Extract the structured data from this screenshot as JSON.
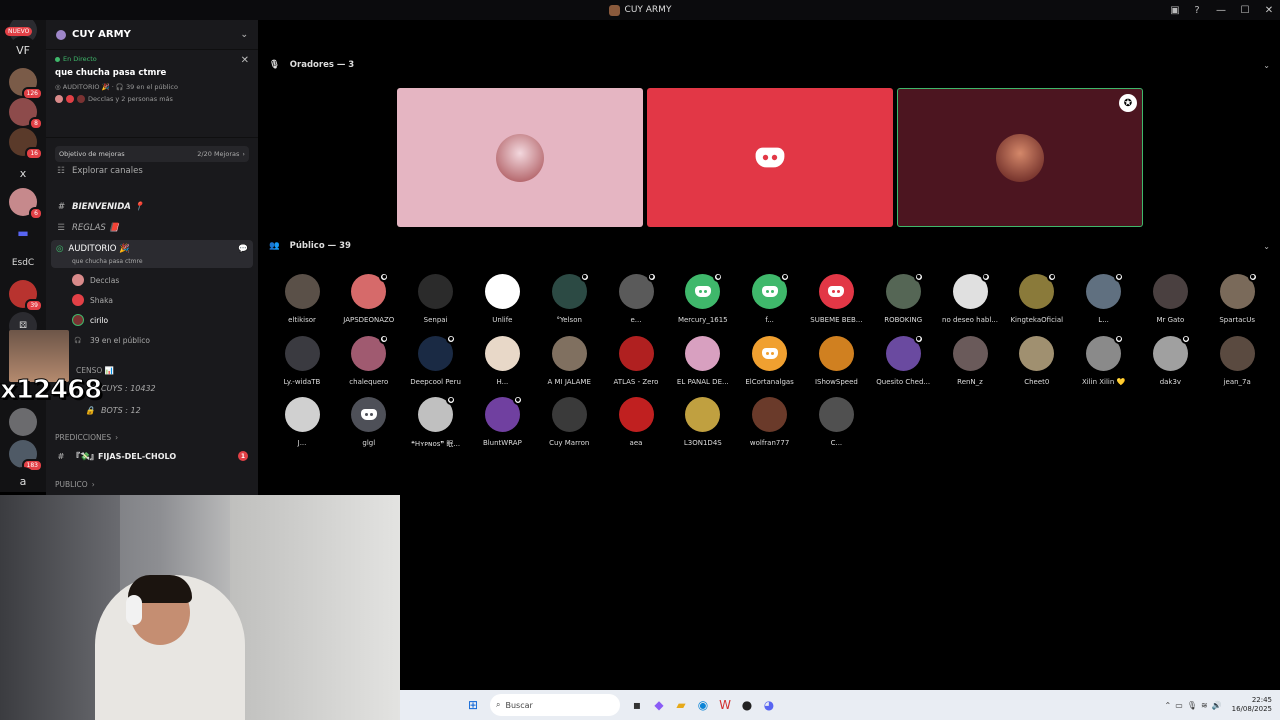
{
  "window": {
    "title": "CUY ARMY"
  },
  "rail": {
    "items": [
      {
        "label": "sr",
        "badge": "NUEVO"
      },
      {
        "label": "VF"
      },
      {
        "badge": "126"
      },
      {
        "badge": "8"
      },
      {
        "badge": "16"
      },
      {
        "label": "x"
      },
      {
        "badge": "6"
      },
      {
        "label": "EsdC"
      },
      {
        "badge": "39"
      },
      {
        "badge": "183"
      },
      {
        "label": "a"
      }
    ]
  },
  "overlay": {
    "number": "x12468"
  },
  "server": {
    "name": "CUY ARMY"
  },
  "live": {
    "status": "En Directo",
    "title": "que chucha pasa ctmre",
    "channel": "AUDITORIO 🎉",
    "audience": "39 en el público",
    "people": "Decclas y 2 personas más"
  },
  "goal": {
    "label": "Objetivo de mejoras",
    "value": "2/20 Mejoras"
  },
  "explore": "Explorar canales",
  "channels": [
    {
      "name": "BIENVENIDA 📍",
      "sym": "#"
    },
    {
      "name": "REGLAS 📕",
      "sym": "☰"
    }
  ],
  "stage_channel": {
    "name": "AUDITORIO 🎉",
    "topic": "que chucha pasa ctmre"
  },
  "stage_members": [
    {
      "name": "Decclas"
    },
    {
      "name": "Shaka"
    },
    {
      "name": "cirilo"
    },
    {
      "name": "39 en el público"
    }
  ],
  "ascenso": {
    "category": "CENSO 📊",
    "cuys": "CUYS : 10432",
    "bots": "BOTS : 12"
  },
  "predicciones": {
    "category": "PREDICCIONES",
    "channel": "『💸』FIJAS-DEL-CHOLO",
    "badge": "1"
  },
  "publico_cat": "PUBLICO",
  "speakers": {
    "header": "Oradores — 3"
  },
  "audience": {
    "header": "Público — 39",
    "members": [
      "eltikisor",
      "JAPSDEONAZO",
      "Senpai",
      "Unlife",
      "°Yelson",
      "e...",
      "Mercury_1615",
      "f...",
      "SUBEME BEB...",
      "ROBOKING",
      "no deseo habl...",
      "KingtekaOficial",
      "L...",
      "Mr Gato",
      "SpartacUs",
      "Ly.-widaTB",
      "chalequero",
      "Deepcool Peru",
      "H...",
      "A MI JALAME",
      "ATLAS - Zero",
      "EL PAÑAL DE...",
      "ElCortanalgas",
      "IShowSpeed",
      "Quesito Ched...",
      "RenN_z",
      "Cheet0",
      "Xilin Xilin 💛",
      "dak3v",
      "jean_7a",
      "J...",
      "glgl",
      "❝Hʏᴘɴᴏs❞ 眠...",
      "BluntWRAP",
      "Cuy Marron",
      "aea",
      "L3ON1D4S",
      "wolfran777",
      "C..."
    ]
  },
  "taskbar": {
    "search_placeholder": "Buscar",
    "time": "22:45",
    "date": "16/08/2025"
  }
}
